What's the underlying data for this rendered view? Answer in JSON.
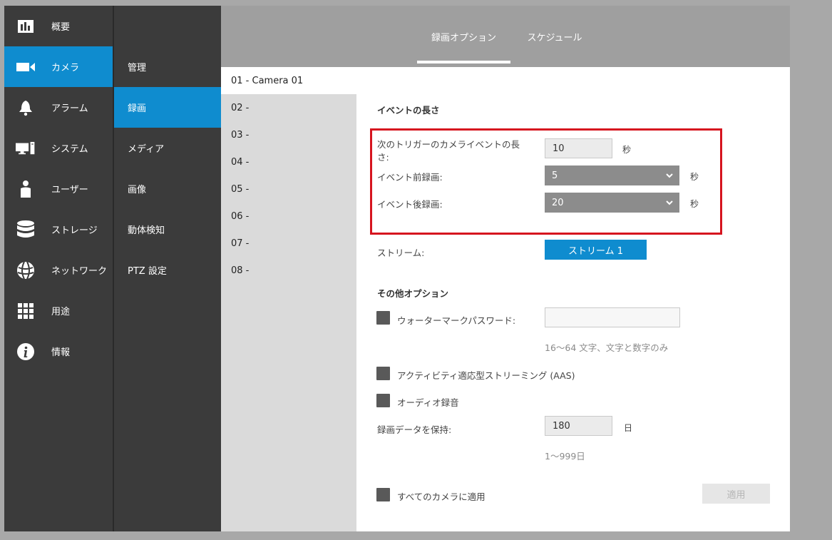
{
  "nav_primary": [
    {
      "label": "概要",
      "icon": "bar-chart-icon"
    },
    {
      "label": "カメラ",
      "icon": "video-camera-icon"
    },
    {
      "label": "アラーム",
      "icon": "bell-icon"
    },
    {
      "label": "システム",
      "icon": "computer-icon"
    },
    {
      "label": "ユーザー",
      "icon": "user-icon"
    },
    {
      "label": "ストレージ",
      "icon": "database-icon"
    },
    {
      "label": "ネットワーク",
      "icon": "globe-icon"
    },
    {
      "label": "用途",
      "icon": "grid-icon"
    },
    {
      "label": "情報",
      "icon": "info-icon"
    }
  ],
  "nav_secondary": [
    {
      "label": "管理"
    },
    {
      "label": "録画"
    },
    {
      "label": "メディア"
    },
    {
      "label": "画像"
    },
    {
      "label": "動体検知"
    },
    {
      "label": "PTZ 設定"
    }
  ],
  "tabs": [
    {
      "label": "録画オプション"
    },
    {
      "label": "スケジュール"
    }
  ],
  "cameras": [
    "01 - Camera 01",
    "02 -",
    "03 -",
    "04 -",
    "05 -",
    "06 -",
    "07 -",
    "08 -"
  ],
  "event_length": {
    "title": "イベントの長さ",
    "trigger_label_line1": "次のトリガーのカメライベントの長",
    "trigger_label_line2": "さ:",
    "trigger_value": "10",
    "trigger_unit": "秒",
    "pre_label": "イベント前録画:",
    "pre_value": "5",
    "pre_unit": "秒",
    "post_label": "イベント後録画:",
    "post_value": "20",
    "post_unit": "秒"
  },
  "stream": {
    "label": "ストリーム:",
    "button": "ストリーム 1"
  },
  "other": {
    "title": "その他オプション",
    "watermark_label": "ウォーターマークパスワード:",
    "watermark_value": "",
    "watermark_hint": "16～64 文字、文字と数字のみ",
    "aas_label": "アクティビティ適応型ストリーミング (AAS)",
    "audio_label": "オーディオ録音",
    "retain_label": "録画データを保持:",
    "retain_value": "180",
    "retain_unit": "日",
    "retain_hint": "1～999日",
    "apply_all_label": "すべてのカメラに適用",
    "apply_button": "適用"
  },
  "colors": {
    "accent": "#0f8ccf",
    "sidebar": "#3b3b3b",
    "header": "#9f9f9f",
    "highlight": "#d6141f"
  }
}
